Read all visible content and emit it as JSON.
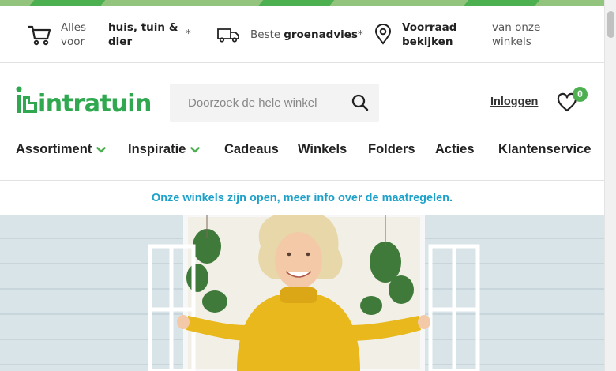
{
  "usp_bar": {
    "items": [
      {
        "icon": "cart-icon",
        "prefix": "Alles voor",
        "bold": "huis, tuin & dier",
        "suffix": "*"
      },
      {
        "icon": "truck-icon",
        "prefix": "Beste",
        "bold": "groenadvies",
        "suffix": "*"
      },
      {
        "icon": "location-pin-icon",
        "bold": "Voorraad bekijken",
        "suffix": "van onze winkels"
      }
    ]
  },
  "header": {
    "logo_text": "intratuin",
    "search_placeholder": "Doorzoek de hele winkel",
    "login_label": "Inloggen",
    "wishlist_count": "0"
  },
  "nav": {
    "items": [
      {
        "label": "Assortiment",
        "has_dropdown": true
      },
      {
        "label": "Inspiratie",
        "has_dropdown": true
      },
      {
        "label": "Cadeaus",
        "has_dropdown": false
      },
      {
        "label": "Winkels",
        "has_dropdown": false
      },
      {
        "label": "Folders",
        "has_dropdown": false
      },
      {
        "label": "Acties",
        "has_dropdown": false
      },
      {
        "label": "Klantenservice",
        "has_dropdown": false
      }
    ]
  },
  "notice": {
    "text": "Onze winkels zijn open, meer info over de maatregelen."
  },
  "colors": {
    "brand_green": "#4caf50",
    "notice_blue": "#1ea1c9",
    "band_green": "#93c47d"
  }
}
